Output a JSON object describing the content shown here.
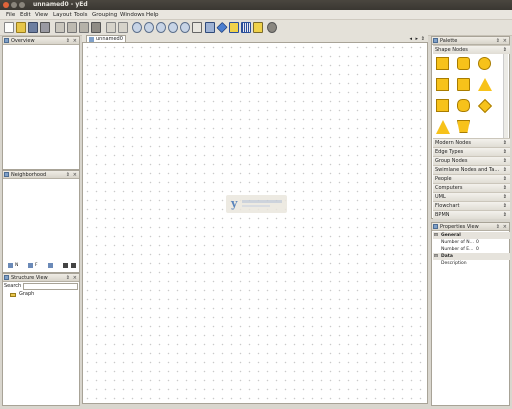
{
  "window": {
    "title": "unnamed0 - yEd"
  },
  "menu": [
    "File",
    "Edit",
    "View",
    "Layout",
    "Tools",
    "Grouping",
    "Windows",
    "Help"
  ],
  "panels": {
    "overview": "Overview",
    "neighborhood": "Neighborhood",
    "structure": "Structure View",
    "palette": "Palette",
    "properties": "Properties View"
  },
  "neighborhood_controls": {
    "field1": "N",
    "field2": "F"
  },
  "structure": {
    "search_label": "Search",
    "tree_root": "Graph"
  },
  "document_tab": "unnamed0",
  "palette": {
    "open_section": "Shape Nodes",
    "sections": [
      "Modern Nodes",
      "Edge Types",
      "Group Nodes",
      "Swimlane Nodes and Ta...",
      "People",
      "Computers",
      "UML",
      "Flowchart",
      "BPMN"
    ]
  },
  "properties": {
    "general": "General",
    "rows": [
      {
        "key": "Number of N...",
        "value": "0"
      },
      {
        "key": "Number of E...",
        "value": "0"
      }
    ],
    "data": "Data",
    "data_rows": [
      {
        "key": "Description",
        "value": ""
      }
    ]
  },
  "colors": {
    "accent": "#f7c21a",
    "titlebar": "#3f3c36",
    "panel_header": "#d8d4ca"
  }
}
